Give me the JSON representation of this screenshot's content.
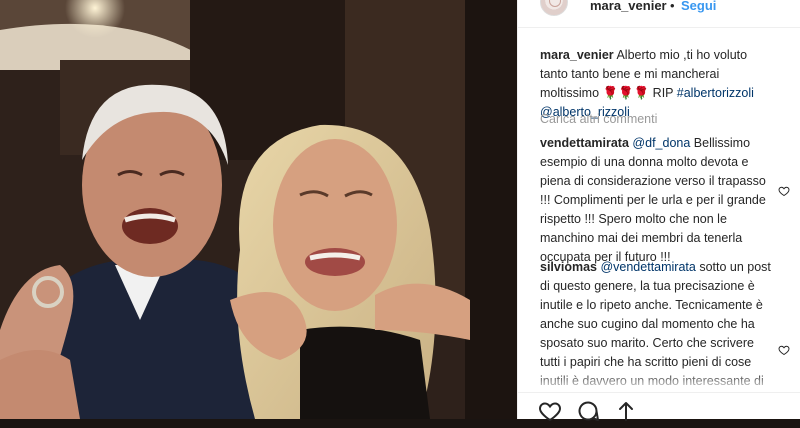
{
  "header": {
    "username": "mara_venier",
    "dot": "•",
    "follow_label": "Segui"
  },
  "caption": {
    "username": "mara_venier",
    "text": "Alberto mio ,ti ho voluto tanto tanto bene e mi mancherai moltissimo 🌹🌹🌹 RIP",
    "hashtag": "#albertorizzoli",
    "mention": "@alberto_rizzoli"
  },
  "load_more_label": "Carica altri commenti",
  "comments": [
    {
      "username": "vendettamirata",
      "mention": "@df_dona",
      "text": "Bellissimo esempio di una donna molto devota e piena di considerazione verso il trapasso !!! Complimenti per le urla e per il grande rispetto !!! Spero molto che non le manchino mai dei membri da tenerla occupata per il futuro !!!"
    },
    {
      "username": "silviomas",
      "mention": "@vendettamirata",
      "text": "sotto un post di questo genere, la tua precisazione è inutile e lo ripeto anche. Tecnicamente è anche suo cugino dal momento che ha sposato suo marito. Certo che scrivere tutti i papiri che ha scritto pieni di cose inutili è davvero un modo interessante di passare la"
    }
  ],
  "icons": {
    "like": "heart-icon",
    "comment": "comment-icon",
    "share": "share-icon",
    "comment_like": "heart-icon"
  },
  "colors": {
    "link": "#3897f0",
    "text": "#262626",
    "muted": "#999999",
    "tag": "#003569"
  }
}
